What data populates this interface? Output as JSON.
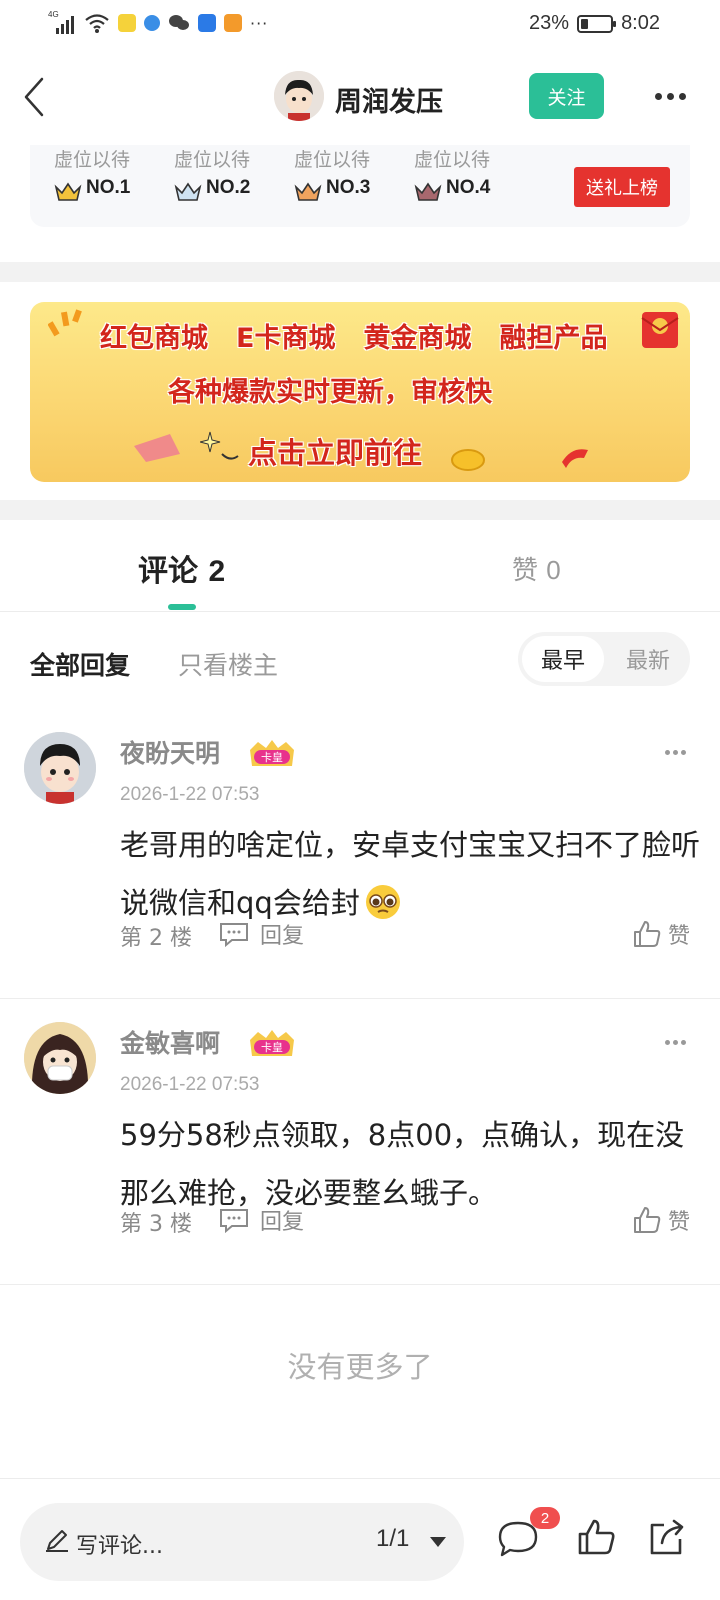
{
  "status_bar": {
    "network": "4G",
    "battery_percent": "23%",
    "time": "8:02",
    "overflow": "···"
  },
  "header": {
    "username": "周润发压",
    "follow_label": "关注"
  },
  "ranking": {
    "slots": [
      {
        "label": "虚位以待",
        "rank": "NO.1"
      },
      {
        "label": "虚位以待",
        "rank": "NO.2"
      },
      {
        "label": "虚位以待",
        "rank": "NO.3"
      },
      {
        "label": "虚位以待",
        "rank": "NO.4"
      }
    ],
    "gift_button": "送礼上榜"
  },
  "banner": {
    "items": [
      "红包商城",
      "E卡商城",
      "黄金商城",
      "融担产品"
    ],
    "subtitle": "各种爆款实时更新，审核快",
    "cta": "点击立即前往"
  },
  "tabs": {
    "comments_label": "评论",
    "comments_count": "2",
    "likes_label": "赞",
    "likes_count": "0"
  },
  "filters": {
    "all": "全部回复",
    "owner_only": "只看楼主",
    "sort_earliest": "最早",
    "sort_newest": "最新"
  },
  "comments": [
    {
      "name": "夜盼天明",
      "badge": "卡皇",
      "time": "2026-1-22 07:53",
      "text": "老哥用的啥定位，安卓支付宝宝又扫不了脸听说微信和qq会给封",
      "emoji": "pleading-face",
      "floor": "第 2 楼",
      "reply": "回复",
      "like": "赞"
    },
    {
      "name": "金敏喜啊",
      "badge": "卡皇",
      "time": "2026-1-22 07:53",
      "text": "59分58秒点领取，8点00，点确认，现在没那么难抢，没必要整幺蛾子。",
      "floor": "第 3 楼",
      "reply": "回复",
      "like": "赞"
    }
  ],
  "no_more": "没有更多了",
  "bottom_bar": {
    "write_placeholder": "写评论...",
    "page_indicator": "1/1",
    "comment_badge": "2"
  },
  "colors": {
    "accent": "#2bbf97",
    "gift_red": "#e5332f",
    "badge_red": "#f04f4f"
  }
}
